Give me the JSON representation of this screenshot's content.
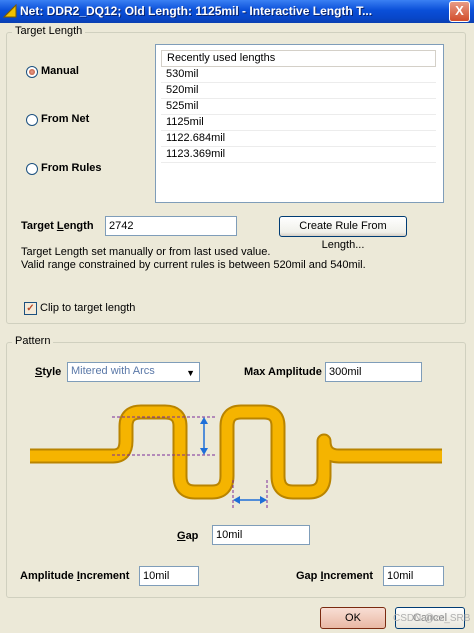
{
  "window": {
    "title": "Net: DDR2_DQ12;  Old Length: 1125mil -  Interactive Length T...",
    "close_glyph": "X"
  },
  "target_length_group": {
    "legend": "Target Length",
    "radios": [
      {
        "label": "Manual",
        "selected": true
      },
      {
        "label": "From Net",
        "selected": false
      },
      {
        "label": "From Rules",
        "selected": false
      }
    ],
    "recent": {
      "header": "Recently used lengths",
      "items": [
        "530mil",
        "520mil",
        "525mil",
        "1125mil",
        "1122.684mil",
        "1123.369mil"
      ]
    },
    "target_length_label_pre": "Target ",
    "target_length_label_key": "L",
    "target_length_label_post": "ength",
    "target_length_value": "2742",
    "create_rule_button": "Create Rule From Length...",
    "info_line1": "Target Length set manually or from last used value.",
    "info_line2": "Valid range constrained by current rules is between 520mil and 540mil.",
    "clip_checkbox": {
      "label": "Clip to target length",
      "checked": true
    }
  },
  "pattern_group": {
    "legend": "Pattern",
    "style_label_key": "S",
    "style_label_post": "tyle",
    "style_value": "Mitered with Arcs",
    "max_amplitude_label": "Max Amplitude",
    "max_amplitude_value": "300mil",
    "gap_label_key": "G",
    "gap_label_post": "ap",
    "gap_value": "10mil",
    "amplitude_increment_label_pre": "Amplitude ",
    "amplitude_increment_label_key": "I",
    "amplitude_increment_label_post": "ncrement",
    "amplitude_increment_value": "10mil",
    "gap_increment_label_pre": "Gap ",
    "gap_increment_label_key": "I",
    "gap_increment_label_post": "ncrement",
    "gap_increment_value": "10mil"
  },
  "footer": {
    "ok_button": "OK",
    "cancel_button": "Cancel",
    "watermark": "CSDN @zz_SRB"
  },
  "colors": {
    "trace": "#f5b400",
    "trace_edge": "#b98400",
    "dimension": "#1e6fd8",
    "guide": "#7a2a9a"
  },
  "icons": [
    "window-icon",
    "close-icon",
    "dropdown-arrow-icon",
    "check-icon"
  ]
}
